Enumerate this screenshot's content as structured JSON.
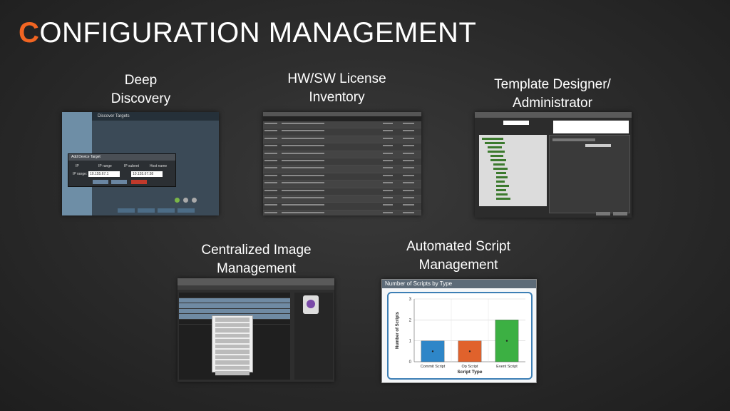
{
  "page": {
    "title_first_letter": "C",
    "title_rest": "ONFIGURATION MANAGEMENT",
    "accent_color": "#f26522"
  },
  "captions": {
    "deep_discovery": [
      "Deep",
      "Discovery"
    ],
    "license_inventory": [
      "HW/SW License",
      "Inventory"
    ],
    "template_designer": [
      "Template Designer/",
      "Administrator"
    ],
    "image_management": [
      "Centralized Image",
      "Management"
    ],
    "script_management": [
      "Automated Script",
      "Management"
    ]
  },
  "deep_discovery_shot": {
    "panel_title": "Discover Targets",
    "dialog_title": "Add Device Target",
    "options": [
      "IP",
      "IP range",
      "IP subnet",
      "Host name"
    ],
    "ip_range_label": "IP range:",
    "ip_from": "10.155.67.1",
    "ip_to": "10.155.67.58"
  },
  "chart_data": {
    "type": "bar",
    "title": "Number of Scripts by Type",
    "categories": [
      "Commit Script",
      "Op Script",
      "Event Script"
    ],
    "values": [
      1,
      1,
      2
    ],
    "colors": [
      "#2e86c8",
      "#e0622c",
      "#3cb043"
    ],
    "xlabel": "Script Type",
    "ylabel": "Number of Scripts",
    "ylim": [
      0,
      3
    ],
    "yticks": [
      0,
      1,
      2,
      3
    ],
    "grid": true
  }
}
